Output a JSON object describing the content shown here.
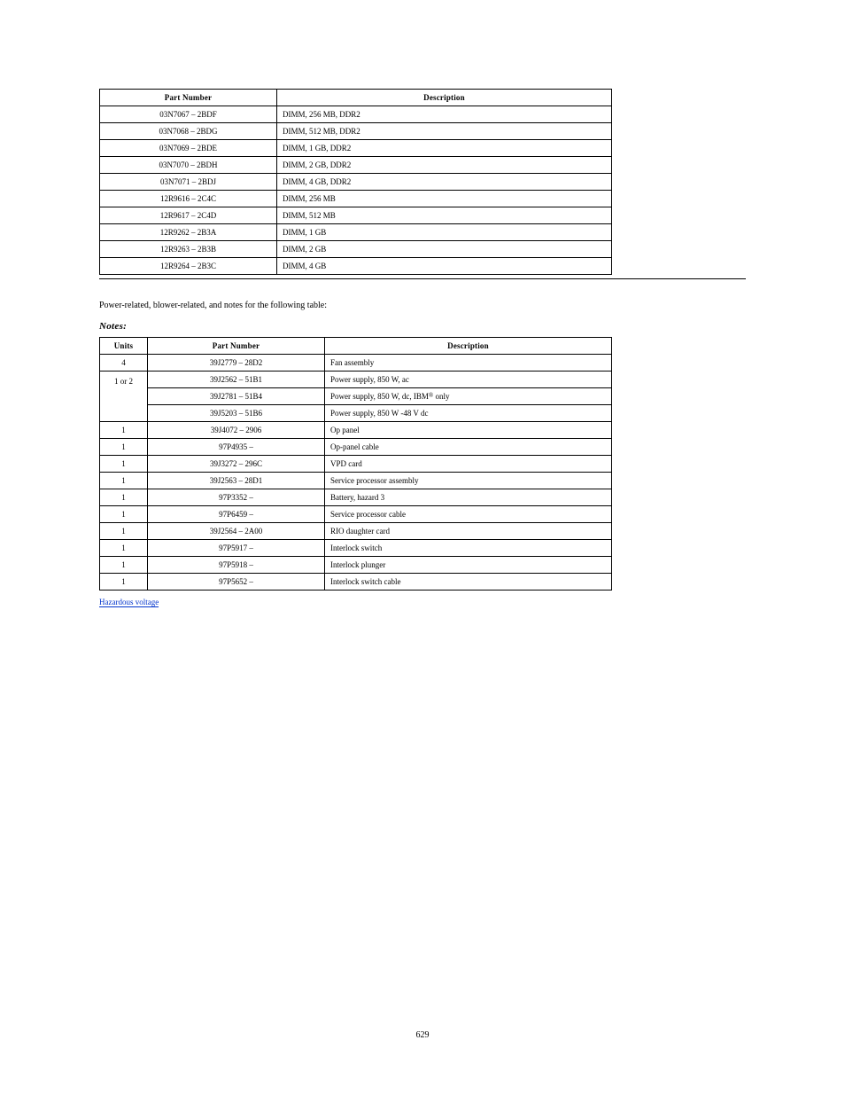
{
  "table1": {
    "headers": {
      "partno": "Part Number",
      "desc": "Description"
    },
    "rows": [
      {
        "partno": "03N7067 – 2BDF",
        "desc": "DIMM, 256 MB, DDR2"
      },
      {
        "partno": "03N7068 – 2BDG",
        "desc": "DIMM, 512 MB, DDR2"
      },
      {
        "partno": "03N7069 – 2BDE",
        "desc": "DIMM, 1 GB, DDR2"
      },
      {
        "partno": "03N7070 – 2BDH",
        "desc": "DIMM, 2 GB, DDR2"
      },
      {
        "partno": "03N7071 – 2BDJ",
        "desc": "DIMM, 4 GB, DDR2"
      },
      {
        "partno": "12R9616 – 2C4C",
        "desc": "DIMM, 256 MB"
      },
      {
        "partno": "12R9617 – 2C4D",
        "desc": "DIMM, 512 MB"
      },
      {
        "partno": "12R9262 – 2B3A",
        "desc": "DIMM, 1 GB"
      },
      {
        "partno": "12R9263 – 2B3B",
        "desc": "DIMM, 2 GB"
      },
      {
        "partno": "12R9264 – 2B3C",
        "desc": "DIMM, 4 GB"
      }
    ]
  },
  "sectionTitle": "Notes:",
  "sectionIntro": "Power-related, blower-related, and notes for the following table:",
  "table2": {
    "headers": {
      "qty": "Units",
      "partno": "Part Number",
      "desc": "Description"
    },
    "rows": [
      {
        "group": "r1",
        "qty": "4",
        "partno": "39J2779 – 28D2",
        "desc": "Fan assembly"
      },
      {
        "group": "g3a",
        "qty": "1 or 2",
        "partno": "39J2562 – 51B1",
        "desc": "Power supply, 850 W, ac"
      },
      {
        "group": "g3b",
        "qty": "",
        "partno": "39J2781 – 51B4",
        "desc": "Power supply, 850 W, dc, IBM® only"
      },
      {
        "group": "g3c",
        "qty": "",
        "partno": "39J5203 – 51B6",
        "desc": "Power supply, 850 W -48 V dc"
      },
      {
        "group": "r3",
        "qty": "1",
        "partno": "39J4072 – 2906",
        "desc": "Op panel"
      },
      {
        "group": "r4",
        "qty": "1",
        "partno": "97P4935 –",
        "desc": "Op-panel cable"
      },
      {
        "group": "r5",
        "qty": "1",
        "partno": "39J3272 – 296C",
        "desc": "VPD card"
      },
      {
        "group": "r6",
        "qty": "1",
        "partno": "39J2563 – 28D1",
        "desc": "Service processor assembly"
      },
      {
        "group": "r7",
        "qty": "1",
        "partno": "97P3352 –",
        "desc": "Battery, hazard 3"
      },
      {
        "group": "r8",
        "qty": "1",
        "partno": "97P6459 –",
        "desc": "Service processor cable"
      },
      {
        "group": "r9",
        "qty": "1",
        "partno": "39J2564 – 2A00",
        "desc": "RIO daughter card"
      },
      {
        "group": "r10",
        "qty": "1",
        "partno": "97P5917 –",
        "desc": "Interlock switch"
      },
      {
        "group": "r11",
        "qty": "1",
        "partno": "97P5918 –",
        "desc": "Interlock plunger"
      },
      {
        "group": "r12",
        "qty": "1",
        "partno": "97P5652 –",
        "desc": "Interlock switch cable"
      }
    ],
    "spanGroup": {
      "start": 1,
      "span": 3
    }
  },
  "linkText": "Hazardous voltage",
  "sup": "®",
  "pageNumber": "629"
}
